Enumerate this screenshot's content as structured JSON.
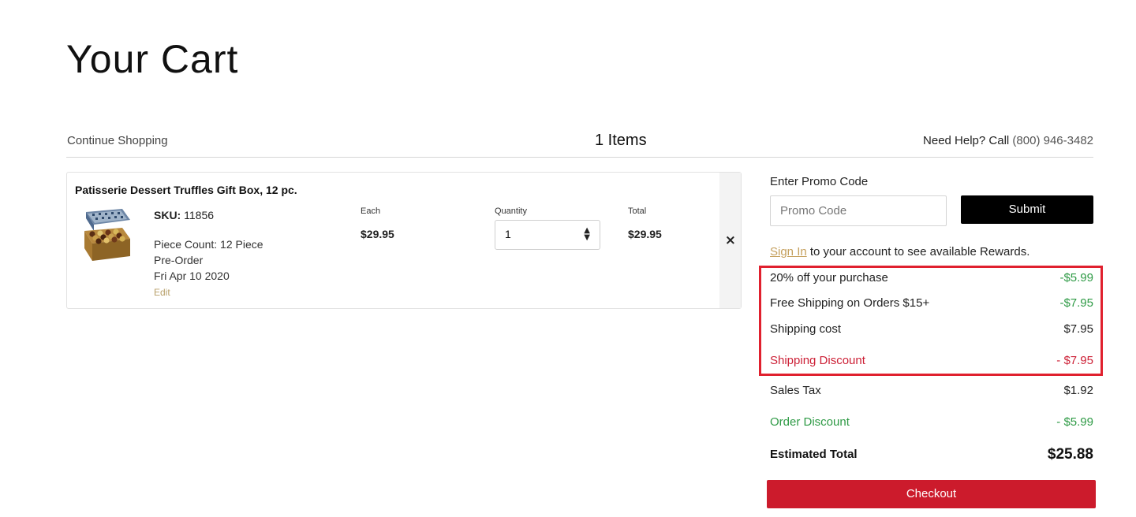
{
  "page": {
    "title": "Your Cart"
  },
  "topbar": {
    "continue_label": "Continue Shopping",
    "items_count": "1 Items",
    "help_prefix": "Need Help? Call",
    "help_phone": "(800) 946-3482"
  },
  "cart_item": {
    "name": "Patisserie Dessert Truffles Gift Box, 12 pc.",
    "image_icon": "truffle-gift-box-image",
    "sku_label": "SKU:",
    "sku_value": "11856",
    "piece_count": "Piece Count: 12 Piece",
    "pre_order": "Pre-Order",
    "date": "Fri Apr 10 2020",
    "edit_label": "Edit",
    "each_label": "Each",
    "each_value": "$29.95",
    "quantity_label": "Quantity",
    "quantity_value": "1",
    "total_label": "Total",
    "total_value": "$29.95",
    "remove_icon": "×"
  },
  "promo": {
    "label": "Enter Promo Code",
    "placeholder": "Promo Code",
    "submit_label": "Submit"
  },
  "signin": {
    "link_label": "Sign In",
    "text": "to your account to see available Rewards."
  },
  "summary": {
    "discount_purchase_label": "20% off your purchase",
    "discount_purchase_value": "-$5.99",
    "free_shipping_label": "Free Shipping on Orders $15+",
    "free_shipping_value": "-$7.95",
    "shipping_cost_label": "Shipping cost",
    "shipping_cost_value": "$7.95",
    "shipping_discount_label": "Shipping Discount",
    "shipping_discount_value": "- $7.95",
    "sales_tax_label": "Sales Tax",
    "sales_tax_value": "$1.92",
    "order_discount_label": "Order Discount",
    "order_discount_value": "- $5.99",
    "estimated_total_label": "Estimated Total",
    "estimated_total_value": "$25.88"
  },
  "checkout": {
    "label": "Checkout"
  },
  "colors": {
    "accent_red": "#cc1b2c",
    "discount_green": "#2e9a45",
    "link_gold": "#c5a05e",
    "highlight_border": "#e0202e"
  }
}
